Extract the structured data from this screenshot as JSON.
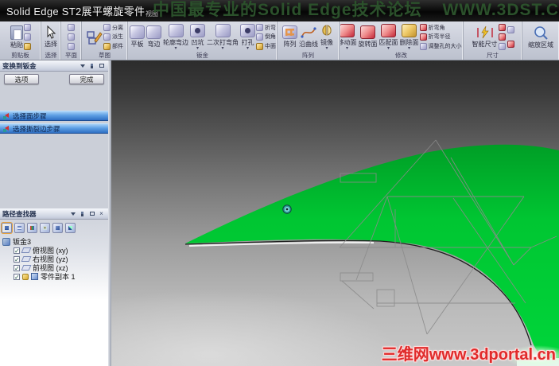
{
  "window": {
    "title": "Solid Edge ST2展平螺旋零件",
    "view_tab": "视图"
  },
  "watermark": {
    "top": "中国最专业的Solid Edge技术论坛",
    "top_right": "WWW.3DST.C",
    "bottom": "三维网www.3dportal.cn"
  },
  "ribbon": {
    "clipboard": {
      "group": "剪贴板",
      "paste": "粘贴"
    },
    "select": {
      "group": "选择",
      "select": "选择"
    },
    "plane": {
      "group": "平面"
    },
    "sketch": {
      "group": "草图",
      "items": [
        "分离",
        "派生",
        "部件"
      ]
    },
    "sheetmetal": {
      "group": "钣金",
      "tab": "平板",
      "flange": "弯边",
      "contour_flange": "轮廓弯边",
      "dimple": "凹坑",
      "jog": "二次打弯角",
      "hole": "打孔",
      "small": [
        "折弯",
        "倒角",
        "中面"
      ]
    },
    "pattern": {
      "group": "阵列",
      "pattern": "阵列",
      "along_curve": "沿曲线",
      "mirror": "镜像"
    },
    "modify": {
      "group": "修改",
      "move_face": "移动面",
      "rotate_face": "旋转面",
      "match_face": "匹配面",
      "delete_face": "删除面",
      "small": [
        "折弯角",
        "折弯半径",
        "调整孔的大小"
      ]
    },
    "dimension": {
      "group": "尺寸",
      "smart": "智能尺寸"
    },
    "zoom_area": "缩放区域"
  },
  "command_bar": {
    "title": "变换到钣金",
    "options": "选项",
    "finish": "完成",
    "steps": [
      "选择面步骤",
      "选择撕裂边步骤"
    ]
  },
  "pathfinder": {
    "title": "路径查找器",
    "root": "钣金3",
    "nodes": [
      {
        "label": "俯视图",
        "axis": "(xy)"
      },
      {
        "label": "右视图",
        "axis": "(yz)"
      },
      {
        "label": "前视图",
        "axis": "(xz)"
      }
    ],
    "part_copy": "零件副本 1",
    "check": "✓"
  },
  "colors": {
    "surface": "#00c832",
    "accent_blue": "#2f6fc4",
    "watermark_red": "#e02a2a"
  }
}
